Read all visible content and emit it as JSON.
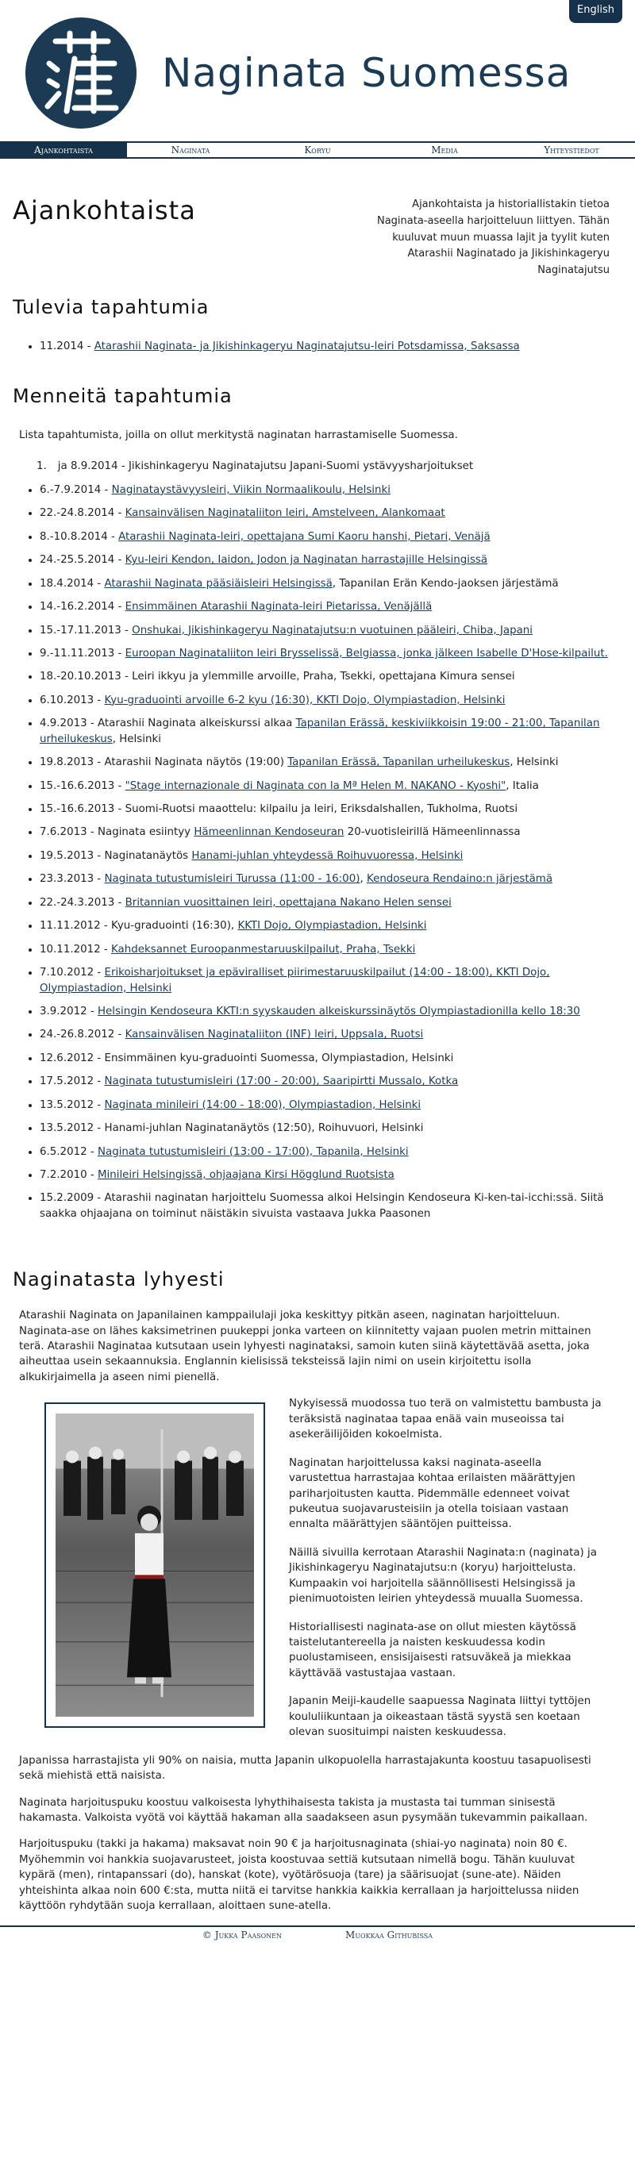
{
  "header": {
    "lang_button": "English",
    "site_title": "Naginata Suomessa",
    "logo_char": "薙"
  },
  "nav": {
    "items": [
      "Ajankohtaista",
      "Naginata",
      "Koryu",
      "Media",
      "Yhteystiedot"
    ],
    "active": "Ajankohtaista"
  },
  "page": {
    "title": "Ajankohtaista",
    "intro": "Ajankohtaista ja historiallistakin tietoa Naginata-aseella harjoitteluun liittyen. Tähän kuuluvat muun muassa lajit ja tyylit kuten Atarashii Naginatado ja Jikishinkageryu Naginatajutsu"
  },
  "upcoming": {
    "title": "Tulevia tapahtumia",
    "items": [
      {
        "date": "11.2014 - ",
        "link": "Atarashii Naginata- ja Jikishinkageryu Naginatajutsu-leiri Potsdamissa, Saksassa",
        "rest": ""
      }
    ]
  },
  "past": {
    "title": "Menneitä tapahtumia",
    "intro": "Lista tapahtumista, joilla on ollut merkitystä naginatan harrastamiselle Suomessa.",
    "first_item": "ja 8.9.2014 - Jikishinkageryu Naginatajutsu Japani-Suomi ystävyysharjoitukset",
    "items": [
      {
        "date": "6.-7.9.2014 - ",
        "link": "Naginataystävyysleiri, Viikin Normaalikoulu, Helsinki",
        "rest": ""
      },
      {
        "date": "22.-24.8.2014 - ",
        "link": "Kansainvälisen Naginataliiton leiri, Amstelveen, Alankomaat",
        "rest": ""
      },
      {
        "date": "8.-10.8.2014 - ",
        "link": "Atarashii Naginata-leiri, opettajana Sumi Kaoru hanshi, Pietari, Venäjä",
        "rest": ""
      },
      {
        "date": "24.-25.5.2014 - ",
        "link": "Kyu-leiri Kendon, Iaidon, Jodon ja Naginatan harrastajille Helsingissä",
        "rest": ""
      },
      {
        "date": "18.4.2014 - ",
        "link": "Atarashii Naginata pääsiäisleiri Helsingissä",
        "rest": ", Tapanilan Erän Kendo-jaoksen järjestämä"
      },
      {
        "date": "14.-16.2.2014 - ",
        "link": "Ensimmäinen Atarashii Naginata-leiri Pietarissa, Venäjällä",
        "rest": ""
      },
      {
        "date": "15.-17.11.2013 - ",
        "link": "Onshukai, Jikishinkageryu Naginatajutsu:n vuotuinen pääleiri, Chiba, Japani",
        "rest": ""
      },
      {
        "date": "9.-11.11.2013 - ",
        "link": "Euroopan Naginataliiton leiri Brysselissä, Belgiassa, jonka jälkeen Isabelle D'Hose-kilpailut.",
        "rest": ""
      },
      {
        "date": "18.-20.10.2013 - ",
        "link": "",
        "rest": "Leiri ikkyu ja ylemmille arvoille, Praha, Tsekki, opettajana Kimura sensei"
      },
      {
        "date": "6.10.2013 - ",
        "link": "Kyu-graduointi arvoille 6-2 kyu (16:30), KKTI Dojo, Olympiastadion, Helsinki",
        "rest": ""
      },
      {
        "date": "4.9.2013 - ",
        "link": "",
        "rest": "Atarashii Naginata alkeiskurssi alkaa ",
        "link2": "Tapanilan Erässä, keskiviikkoisin 19:00 - 21:00, Tapanilan urheilukeskus",
        "rest2": ", Helsinki"
      },
      {
        "date": "19.8.2013 - ",
        "link": "",
        "rest": "Atarashii Naginata näytös (19:00) ",
        "link2": "Tapanilan Erässä, Tapanilan urheilukeskus",
        "rest2": ", Helsinki"
      },
      {
        "date": "15.-16.6.2013 - ",
        "link": "\"Stage internazionale di Naginata con la Mª Helen M. NAKANO - Kyoshi\"",
        "rest": ", Italia"
      },
      {
        "date": "15.-16.6.2013 - ",
        "link": "",
        "rest": "Suomi-Ruotsi maaottelu: kilpailu ja leiri, Eriksdalshallen, Tukholma, Ruotsi"
      },
      {
        "date": "7.6.2013 - ",
        "link": "",
        "rest": "Naginata esiintyy ",
        "link2": "Hämeenlinnan Kendoseuran",
        "rest2": " 20-vuotisleirillä Hämeenlinnassa"
      },
      {
        "date": "19.5.2013 - ",
        "link": "",
        "rest": "Naginatanäytös ",
        "link2": "Hanami-juhlan yhteydessä Roihuvuoressa, Helsinki",
        "rest2": ""
      },
      {
        "date": "23.3.2013 - ",
        "link": "Naginata tutustumisleiri Turussa (11:00 - 16:00)",
        "rest": ", ",
        "link2": "Kendoseura Rendaino:n järjestämä",
        "rest2": ""
      },
      {
        "date": "22.-24.3.2013 - ",
        "link": "Britannian vuosittainen leiri, opettajana Nakano Helen sensei",
        "rest": ""
      },
      {
        "date": "11.11.2012 - ",
        "link": "",
        "rest": "Kyu-graduointi (16:30), ",
        "link2": "KKTI Dojo, Olympiastadion, Helsinki",
        "rest2": ""
      },
      {
        "date": "10.11.2012 - ",
        "link": "Kahdeksannet Euroopanmestaruuskilpailut, Praha, Tsekki",
        "rest": ""
      },
      {
        "date": "7.10.2012 - ",
        "link": "Erikoisharjoitukset ja epäviralliset piirimestaruuskilpailut (14:00 - 18:00), KKTI Dojo, Olympiastadion, Helsinki",
        "rest": ""
      },
      {
        "date": "3.9.2012 - ",
        "link": "Helsingin Kendoseura KKTI:n syyskauden alkeiskurssinäytös Olympiastadionilla kello 18:30",
        "rest": ""
      },
      {
        "date": "24.-26.8.2012 - ",
        "link": "Kansainvälisen Naginataliiton (INF) leiri, Uppsala, Ruotsi",
        "rest": ""
      },
      {
        "date": "12.6.2012 - ",
        "link": "",
        "rest": "Ensimmäinen kyu-graduointi Suomessa, Olympiastadion, Helsinki"
      },
      {
        "date": "17.5.2012 - ",
        "link": "Naginata tutustumisleiri (17:00 - 20:00), Saaripirtti Mussalo, Kotka",
        "rest": ""
      },
      {
        "date": "13.5.2012 - ",
        "link": "Naginata minileiri (14:00 - 18:00), Olympiastadion, Helsinki",
        "rest": ""
      },
      {
        "date": "13.5.2012 - ",
        "link": "",
        "rest": "Hanami-juhlan Naginatanäytös (12:50), Roihuvuori, Helsinki"
      },
      {
        "date": "6.5.2012 - ",
        "link": "Naginata tutustumisleiri (13:00 - 17:00), Tapanila, Helsinki",
        "rest": ""
      },
      {
        "date": "7.2.2010 - ",
        "link": "Minileiri Helsingissä, ohjaajana Kirsi Högglund Ruotsista",
        "rest": ""
      },
      {
        "date": "15.2.2009 - ",
        "link": "",
        "rest": "Atarashii naginatan harjoittelu Suomessa alkoi Helsingin Kendoseura Ki-ken-tai-icchi:ssä. Siitä saakka ohjaajana on toiminut näistäkin sivuista vastaava Jukka Paasonen"
      }
    ]
  },
  "brief": {
    "title": "Naginatasta lyhyesti",
    "p1": "Atarashii Naginata on Japanilainen kamppailulaji joka keskittyy pitkän aseen, naginatan harjoitteluun. Naginata-ase on lähes kaksimetrinen puukeppi jonka varteen on kiinnitetty vajaan puolen metrin mittainen terä. Atarashii Naginataa kutsutaan usein lyhyesti naginataksi, samoin kuten siinä käytettävää asetta, joka aiheuttaa usein sekaannuksia. Englannin kielisissä teksteissä lajin nimi on usein kirjoitettu isolla alkukirjaimella ja aseen nimi pienellä.",
    "side": [
      "Nykyisessä muodossa tuo terä on valmistettu bambusta ja teräksistä naginataa tapaa enää vain museoissa tai asekeräilijöiden kokoelmista.",
      "Naginatan harjoittelussa kaksi naginata-aseella varustettua harrastajaa kohtaa erilaisten määrättyjen pariharjoitusten kautta. Pidemmälle edenneet voivat pukeutua suojavarusteisiin ja otella toisiaan vastaan ennalta määrättyjen sääntöjen puitteissa.",
      "Näillä sivuilla kerrotaan Atarashii Naginata:n (naginata) ja Jikishinkageryu Naginatajutsu:n (koryu) harjoittelusta. Kumpaakin voi harjoitella säännöllisesti Helsingissä ja pienimuotoisten leirien yhteydessä muualla Suomessa.",
      "Historiallisesti naginata-ase on ollut miesten käytössä taistelutantereella ja naisten keskuudessa kodin puolustamiseen, ensisijaisesti ratsuväkeä ja miekkaa käyttävää vastustajaa vastaan."
    ],
    "p_meiji": "Japanin Meiji-kaudelle saapuessa Naginata liittyi tyttöjen koululiikuntaan ja oikeastaan tästä syystä sen koetaan olevan suosituimpi naisten keskuudessa.",
    "p_japan": "Japanissa harrastajista yli 90% on naisia, mutta Japanin ulkopuolella harrastajakunta koostuu tasapuolisesti sekä miehistä että naisista.",
    "p_dress": "Naginata harjoituspuku koostuu valkoisesta lyhythihaisesta takista ja mustasta tai tumman sinisestä hakamasta. Valkoista vyötä voi käyttää hakaman alla saadakseen asun pysymään tukevammin paikallaan.",
    "p_cost": "Harjoituspuku (takki ja hakama) maksavat noin 90 € ja harjoitusnaginata (shiai-yo naginata) noin 80 €. Myöhemmin voi hankkia suojavarusteet, joista koostuvaa settiä kutsutaan nimellä bogu. Tähän kuuluvat kypärä (men), rintapanssari (do), hanskat (kote), vyötärösuoja (tare) ja säärisuojat (sune-ate). Näiden yhteishinta alkaa noin 600 €:sta, mutta niitä ei tarvitse hankkia kaikkia kerrallaan ja harjoittelussa niiden käyttöön ryhdytään suoja kerrallaan, aloittaen sune-atella."
  },
  "footer": {
    "copyright": "© Jukka Paasonen",
    "edit": "Muokkaa Githubissa"
  }
}
